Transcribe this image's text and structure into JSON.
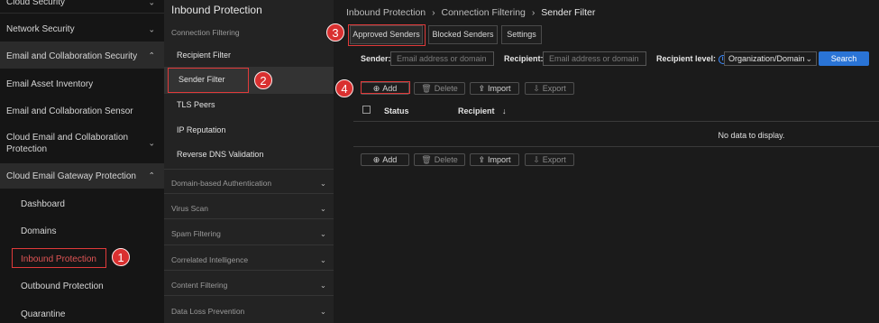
{
  "sidebar": {
    "items": [
      {
        "label": "Cloud Security",
        "chevron": "⌄"
      },
      {
        "label": "Network Security",
        "chevron": "⌄"
      },
      {
        "label": "Email and Collaboration Security",
        "chevron": "⌃"
      },
      {
        "label": "Email Asset Inventory"
      },
      {
        "label": "Email and Collaboration Sensor"
      },
      {
        "label": "Cloud Email and Collaboration Protection",
        "chevron": "⌄"
      },
      {
        "label": "Cloud Email Gateway Protection",
        "chevron": "⌃"
      },
      {
        "label": "Dashboard"
      },
      {
        "label": "Domains"
      },
      {
        "label": "Inbound Protection"
      },
      {
        "label": "Outbound Protection"
      },
      {
        "label": "Quarantine"
      }
    ]
  },
  "subnav": {
    "title": "Inbound Protection",
    "section": "Connection Filtering",
    "items": [
      "Recipient Filter",
      "Sender Filter",
      "TLS Peers",
      "IP Reputation",
      "Reverse DNS Validation"
    ],
    "accordions": [
      "Domain-based Authentication",
      "Virus Scan",
      "Spam Filtering",
      "Correlated Intelligence",
      "Content Filtering",
      "Data Loss Prevention"
    ]
  },
  "breadcrumb": {
    "part1": "Inbound Protection",
    "part2": "Connection Filtering",
    "current": "Sender Filter",
    "sep": "›"
  },
  "tabs": [
    "Approved Senders",
    "Blocked Senders",
    "Settings"
  ],
  "filters": {
    "sender_label": "Sender:",
    "sender_placeholder": "Email address or domain",
    "recipient_label": "Recipient:",
    "recipient_placeholder": "Email address or domain",
    "level_label": "Recipient level:",
    "level_value": "Organization/Domain",
    "search_label": "Search"
  },
  "toolbar": {
    "add": "Add",
    "delete": "Delete",
    "import": "Import",
    "export": "Export"
  },
  "table": {
    "col_status": "Status",
    "col_recipient": "Recipient",
    "sort_icon": "↓",
    "empty": "No data to display."
  },
  "callouts": [
    "1",
    "2",
    "3",
    "4"
  ],
  "colors": {
    "accent": "#2a74d6",
    "highlight": "#e03a3a"
  }
}
